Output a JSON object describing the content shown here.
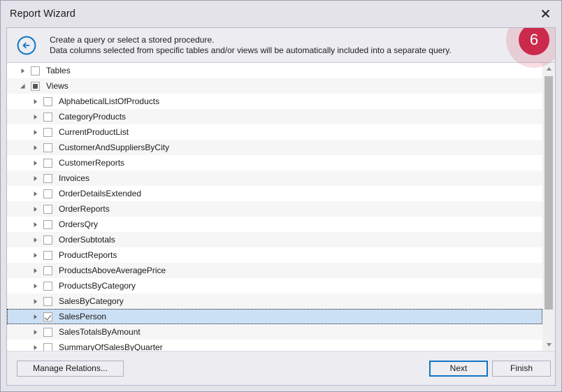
{
  "window": {
    "title": "Report Wizard",
    "close_label": "✕"
  },
  "header": {
    "back_icon": "back-arrow-circle-icon",
    "line1": "Create a query or select a stored procedure.",
    "line2": "Data columns selected from specific tables and/or views will be automatically included into a separate query.",
    "badge": "6",
    "badge_color": "#cb2a4d",
    "accent_color": "#1275c4"
  },
  "tree": {
    "nodes": [
      {
        "label": "Tables",
        "level": 0,
        "expanded": false,
        "check": "unchecked",
        "selected": false
      },
      {
        "label": "Views",
        "level": 0,
        "expanded": true,
        "check": "indeterminate",
        "selected": false
      },
      {
        "label": "AlphabeticalListOfProducts",
        "level": 1,
        "expanded": false,
        "check": "unchecked",
        "selected": false
      },
      {
        "label": "CategoryProducts",
        "level": 1,
        "expanded": false,
        "check": "unchecked",
        "selected": false
      },
      {
        "label": "CurrentProductList",
        "level": 1,
        "expanded": false,
        "check": "unchecked",
        "selected": false
      },
      {
        "label": "CustomerAndSuppliersByCity",
        "level": 1,
        "expanded": false,
        "check": "unchecked",
        "selected": false
      },
      {
        "label": "CustomerReports",
        "level": 1,
        "expanded": false,
        "check": "unchecked",
        "selected": false
      },
      {
        "label": "Invoices",
        "level": 1,
        "expanded": false,
        "check": "unchecked",
        "selected": false
      },
      {
        "label": "OrderDetailsExtended",
        "level": 1,
        "expanded": false,
        "check": "unchecked",
        "selected": false
      },
      {
        "label": "OrderReports",
        "level": 1,
        "expanded": false,
        "check": "unchecked",
        "selected": false
      },
      {
        "label": "OrdersQry",
        "level": 1,
        "expanded": false,
        "check": "unchecked",
        "selected": false
      },
      {
        "label": "OrderSubtotals",
        "level": 1,
        "expanded": false,
        "check": "unchecked",
        "selected": false
      },
      {
        "label": "ProductReports",
        "level": 1,
        "expanded": false,
        "check": "unchecked",
        "selected": false
      },
      {
        "label": "ProductsAboveAveragePrice",
        "level": 1,
        "expanded": false,
        "check": "unchecked",
        "selected": false
      },
      {
        "label": "ProductsByCategory",
        "level": 1,
        "expanded": false,
        "check": "unchecked",
        "selected": false
      },
      {
        "label": "SalesByCategory",
        "level": 1,
        "expanded": false,
        "check": "unchecked",
        "selected": false
      },
      {
        "label": "SalesPerson",
        "level": 1,
        "expanded": false,
        "check": "checked",
        "selected": true
      },
      {
        "label": "SalesTotalsByAmount",
        "level": 1,
        "expanded": false,
        "check": "unchecked",
        "selected": false
      },
      {
        "label": "SummaryOfSalesByQuarter",
        "level": 1,
        "expanded": false,
        "check": "unchecked",
        "selected": false
      }
    ]
  },
  "scrollbar": {
    "up_icon": "scroll-up-arrow-icon",
    "down_icon": "scroll-down-arrow-icon"
  },
  "footer": {
    "manage_relations_label": "Manage Relations...",
    "next_label": "Next",
    "finish_label": "Finish"
  }
}
